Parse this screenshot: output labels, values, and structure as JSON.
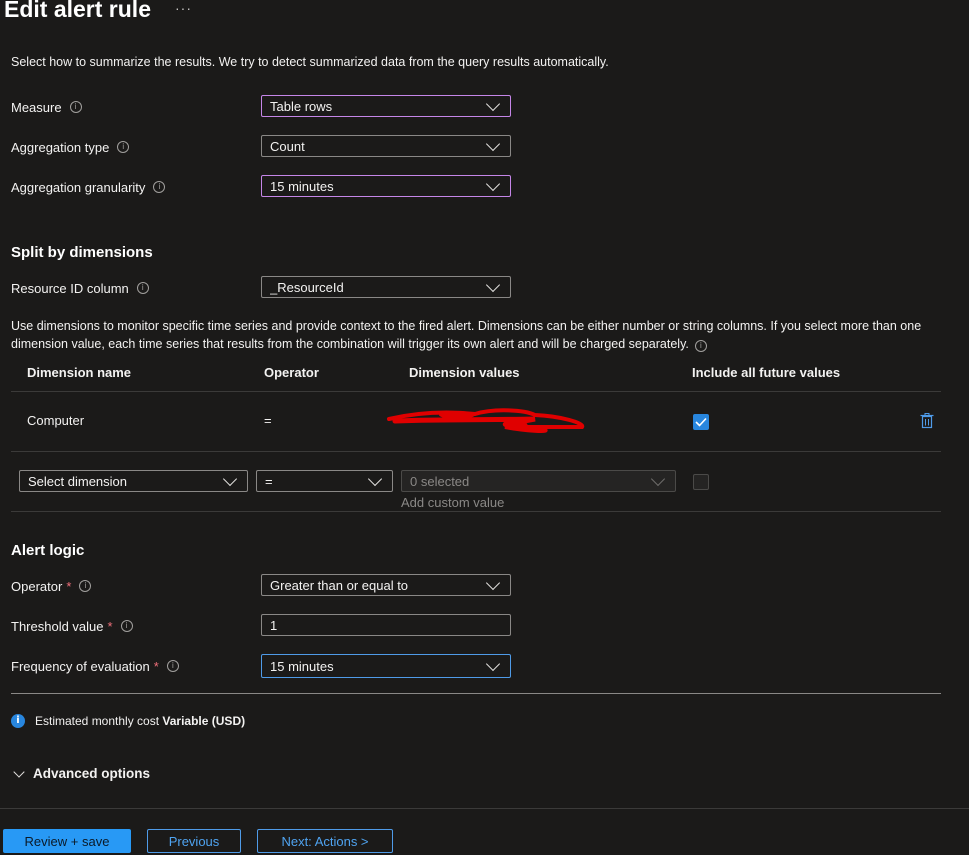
{
  "header": {
    "title": "Edit alert rule",
    "more": "···"
  },
  "intro": "Select how to summarize the results. We try to detect summarized data from the query results automatically.",
  "measure": {
    "label": "Measure",
    "value": "Table rows"
  },
  "aggregation_type": {
    "label": "Aggregation type",
    "value": "Count"
  },
  "aggregation_granularity": {
    "label": "Aggregation granularity",
    "value": "15 minutes"
  },
  "split": {
    "heading": "Split by dimensions",
    "resource_id": {
      "label": "Resource ID column",
      "value": "_ResourceId"
    },
    "description": "Use dimensions to monitor specific time series and provide context to the fired alert. Dimensions can be either number or string columns. If you select more than one dimension value, each time series that results from the combination will trigger its own alert and will be charged separately.",
    "columns": [
      "Dimension name",
      "Operator",
      "Dimension values",
      "Include all future values"
    ],
    "row": {
      "name": "Computer",
      "operator": "=",
      "include_future": true
    },
    "new_row": {
      "dimension_placeholder": "Select dimension",
      "operator": "=",
      "values_placeholder": "0 selected",
      "add_custom": "Add custom value",
      "include_future": false
    }
  },
  "alert_logic": {
    "heading": "Alert logic",
    "operator": {
      "label": "Operator",
      "value": "Greater than or equal to"
    },
    "threshold": {
      "label": "Threshold value",
      "value": "1"
    },
    "frequency": {
      "label": "Frequency of evaluation",
      "value": "15 minutes"
    },
    "required_mark": "*"
  },
  "cost": {
    "prefix": "Estimated monthly cost",
    "value": "Variable (USD)"
  },
  "advanced": {
    "label": "Advanced options"
  },
  "footer": {
    "review": "Review + save",
    "previous": "Previous",
    "next": "Next: Actions >"
  },
  "icons": [
    "info-icon",
    "chevron-down-icon",
    "delete-icon",
    "checkmark-icon",
    "more-icon"
  ],
  "colors": {
    "accent": "#2899f5",
    "focus": "#c586e8",
    "required": "#f1707b",
    "redaction": "#e00000"
  }
}
